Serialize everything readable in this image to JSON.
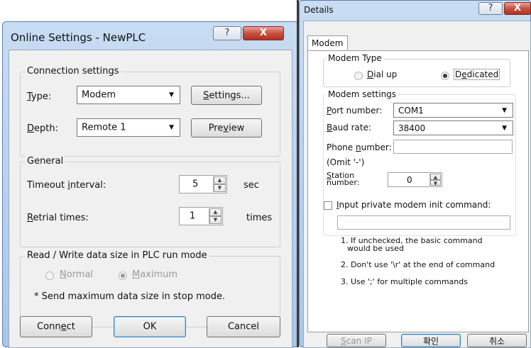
{
  "online": {
    "title": "Online Settings - NewPLC",
    "help_btn": "?",
    "close_btn": "X",
    "conn_group": "Connection settings",
    "type_label": "Type:",
    "type_value": "Modem",
    "settings_btn": "Settings...",
    "depth_label": "Depth:",
    "depth_value": "Remote 1",
    "preview_btn": "Preview",
    "general_group": "General",
    "timeout_label": "Timeout interval:",
    "timeout_value": "5",
    "timeout_unit": "sec",
    "retrial_label": "Retrial times:",
    "retrial_value": "1",
    "retrial_unit": "times",
    "rw_group": "Read / Write data size in PLC run mode",
    "normal_label": "Normal",
    "maximum_label": "Maximum",
    "stop_note": "* Send maximum data size in stop mode.",
    "connect_btn": "Connect",
    "ok_btn": "OK",
    "cancel_btn": "Cancel"
  },
  "details": {
    "title": "Details",
    "help_btn": "?",
    "close_btn": "X",
    "tab": "Modem",
    "modem_type_group": "Modem Type",
    "dialup_label": "Dial up",
    "dedicated_label": "Dedicated",
    "modem_settings_group": "Modem settings",
    "port_label": "Port number:",
    "port_value": "COM1",
    "baud_label": "Baud rate:",
    "baud_value": "38400",
    "phone_label": "Phone number:",
    "phone_value": "",
    "omit_note": "(Omit '-')",
    "station_label_1": "Station",
    "station_label_2": "number:",
    "station_value": "0",
    "private_cmd_label": "Input private modem init command:",
    "private_cmd_value": "",
    "note1a": "1. If unchecked, the basic command",
    "note1b": "would be used",
    "note2": "2. Don't use '\\r' at the end of command",
    "note3": "3. Use ';' for multiple commands",
    "scanip_btn": "Scan IP",
    "ok_btn": "확인",
    "cancel_btn": "취소"
  }
}
